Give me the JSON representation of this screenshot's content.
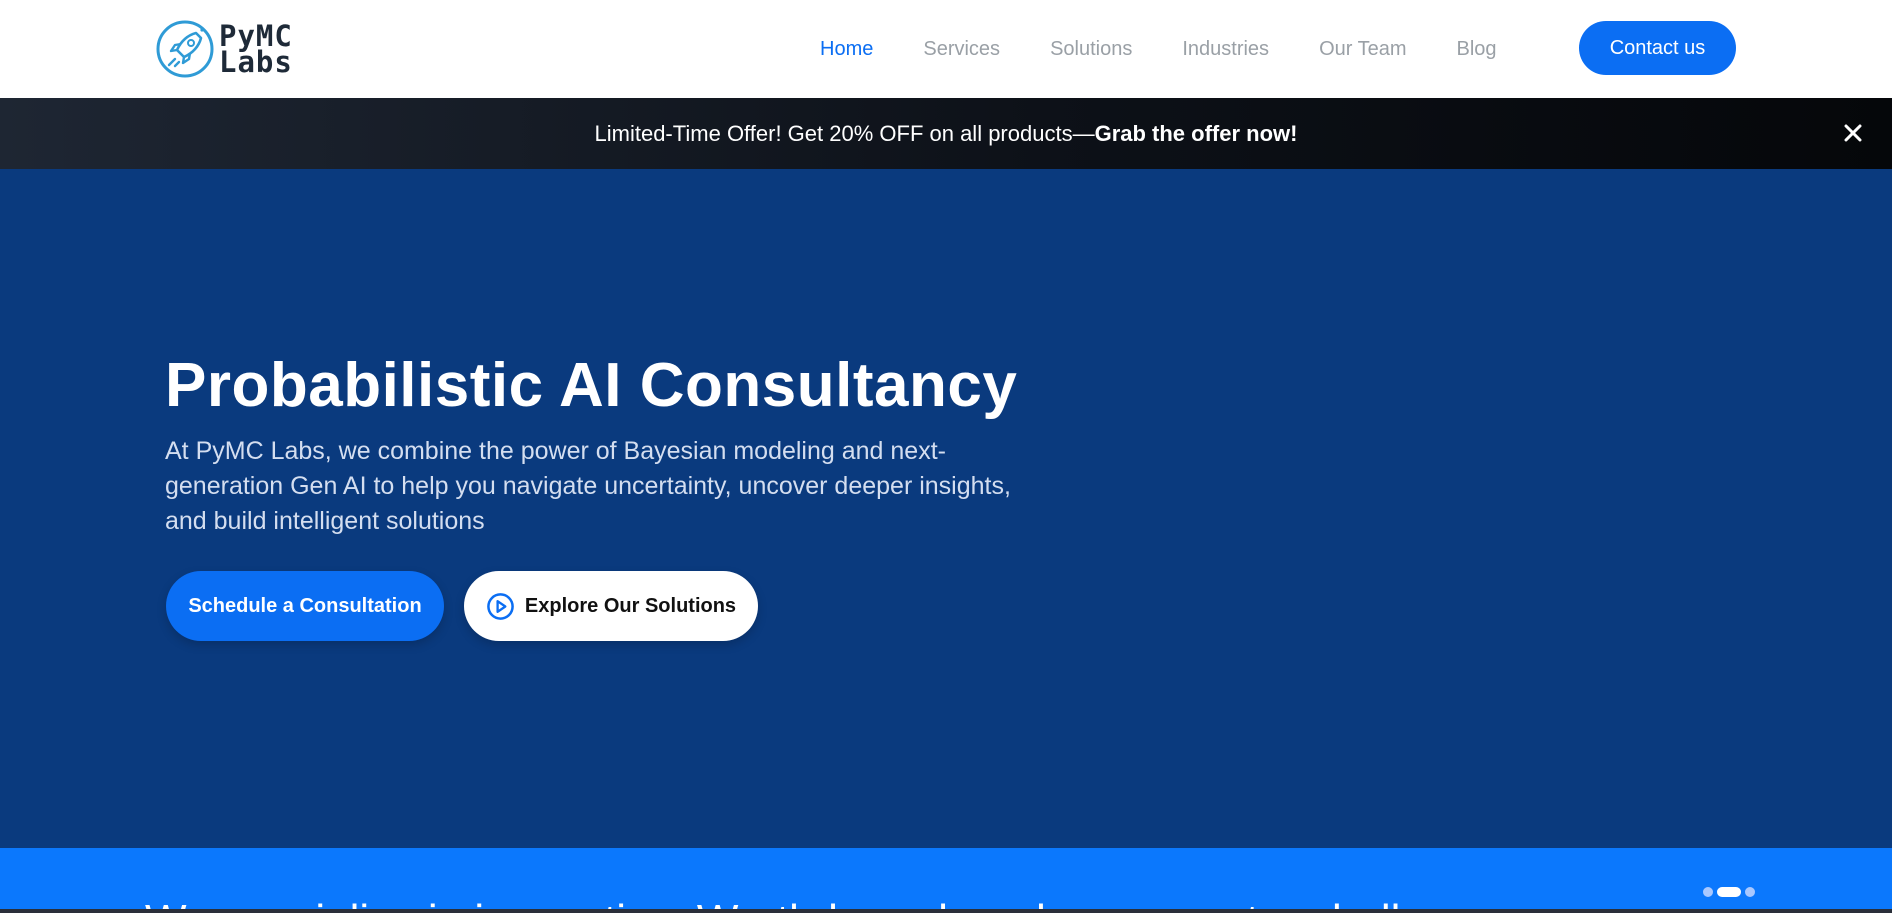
{
  "header": {
    "logo_line1": "PyMC",
    "logo_line2": "Labs",
    "nav": [
      {
        "label": "Home",
        "active": true
      },
      {
        "label": "Services",
        "active": false
      },
      {
        "label": "Solutions",
        "active": false
      },
      {
        "label": "Industries",
        "active": false
      },
      {
        "label": "Our Team",
        "active": false
      },
      {
        "label": "Blog",
        "active": false
      }
    ],
    "contact_label": "Contact us"
  },
  "promo": {
    "text": "Limited-Time Offer! Get 20% OFF on all products—",
    "link": "Grab the offer now!",
    "close_icon": "close-icon"
  },
  "hero": {
    "title": "Probabilistic AI Consultancy",
    "subtitle": "At PyMC Labs, we combine the power of Bayesian modeling and next-generation Gen AI to help you navigate uncertainty, uncover deeper insights, and build intelligent solutions",
    "primary_cta": "Schedule a Consultation",
    "secondary_cta": "Explore Our Solutions",
    "secondary_icon": "play-circle-icon"
  },
  "strip": {
    "text": "We specialize in innovative, Worth-based, and cross-sector challenges"
  },
  "colors": {
    "accent": "#0b6ef3",
    "hero_bg": "#0a3a7e",
    "strip_bg": "#0b78fd",
    "nav_inactive": "#9aa0a6"
  }
}
